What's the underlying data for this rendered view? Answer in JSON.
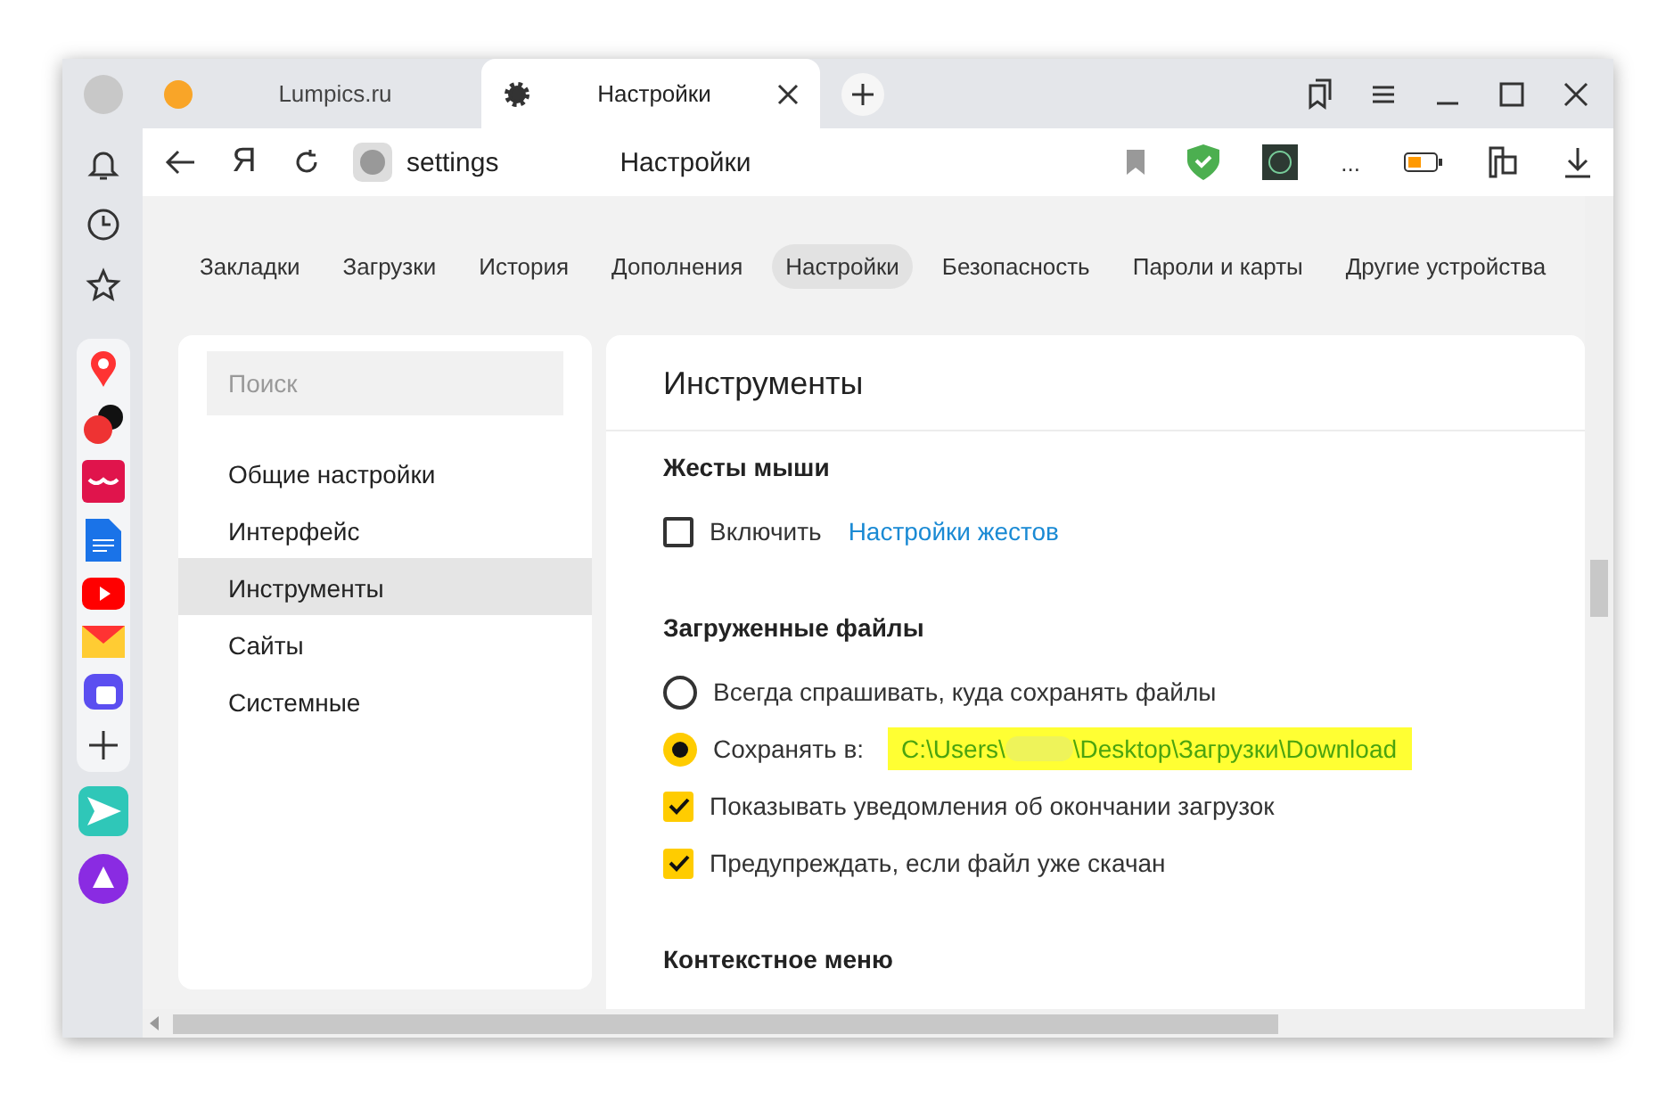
{
  "tabs": [
    {
      "title": "Lumpics.ru",
      "selected": false
    },
    {
      "title": "Настройки",
      "selected": true
    }
  ],
  "toolbar": {
    "logo": "Я",
    "url": "settings",
    "page_title": "Настройки",
    "overflow": "..."
  },
  "nav": [
    {
      "label": "Закладки",
      "selected": false
    },
    {
      "label": "Загрузки",
      "selected": false
    },
    {
      "label": "История",
      "selected": false
    },
    {
      "label": "Дополнения",
      "selected": false
    },
    {
      "label": "Настройки",
      "selected": true
    },
    {
      "label": "Безопасность",
      "selected": false
    },
    {
      "label": "Пароли и карты",
      "selected": false
    },
    {
      "label": "Другие устройства",
      "selected": false
    }
  ],
  "search": {
    "placeholder": "Поиск"
  },
  "sidebar": {
    "items": [
      {
        "label": "Общие настройки",
        "selected": false
      },
      {
        "label": "Интерфейс",
        "selected": false
      },
      {
        "label": "Инструменты",
        "selected": true
      },
      {
        "label": "Сайты",
        "selected": false
      },
      {
        "label": "Системные",
        "selected": false
      }
    ]
  },
  "panel": {
    "title": "Инструменты",
    "sections": [
      {
        "title": "Жесты мыши",
        "rows": [
          {
            "kind": "checkbox",
            "label": "Включить",
            "checked": false,
            "link": "Настройки жестов"
          }
        ]
      },
      {
        "title": "Загруженные файлы",
        "rows": [
          {
            "kind": "radio",
            "label": "Всегда спрашивать, куда сохранять файлы",
            "selected": false
          },
          {
            "kind": "radio",
            "label": "Сохранять в:",
            "selected": true,
            "path_start": "C:\\Users\\",
            "path_end": "\\Desktop\\Загрузки\\Download"
          },
          {
            "kind": "checkbox",
            "label": "Показывать уведомления об окончании загрузок",
            "checked": true
          },
          {
            "kind": "checkbox",
            "label": "Предупреждать, если файл уже скачан",
            "checked": true
          }
        ]
      },
      {
        "title": "Контекстное меню"
      }
    ]
  }
}
